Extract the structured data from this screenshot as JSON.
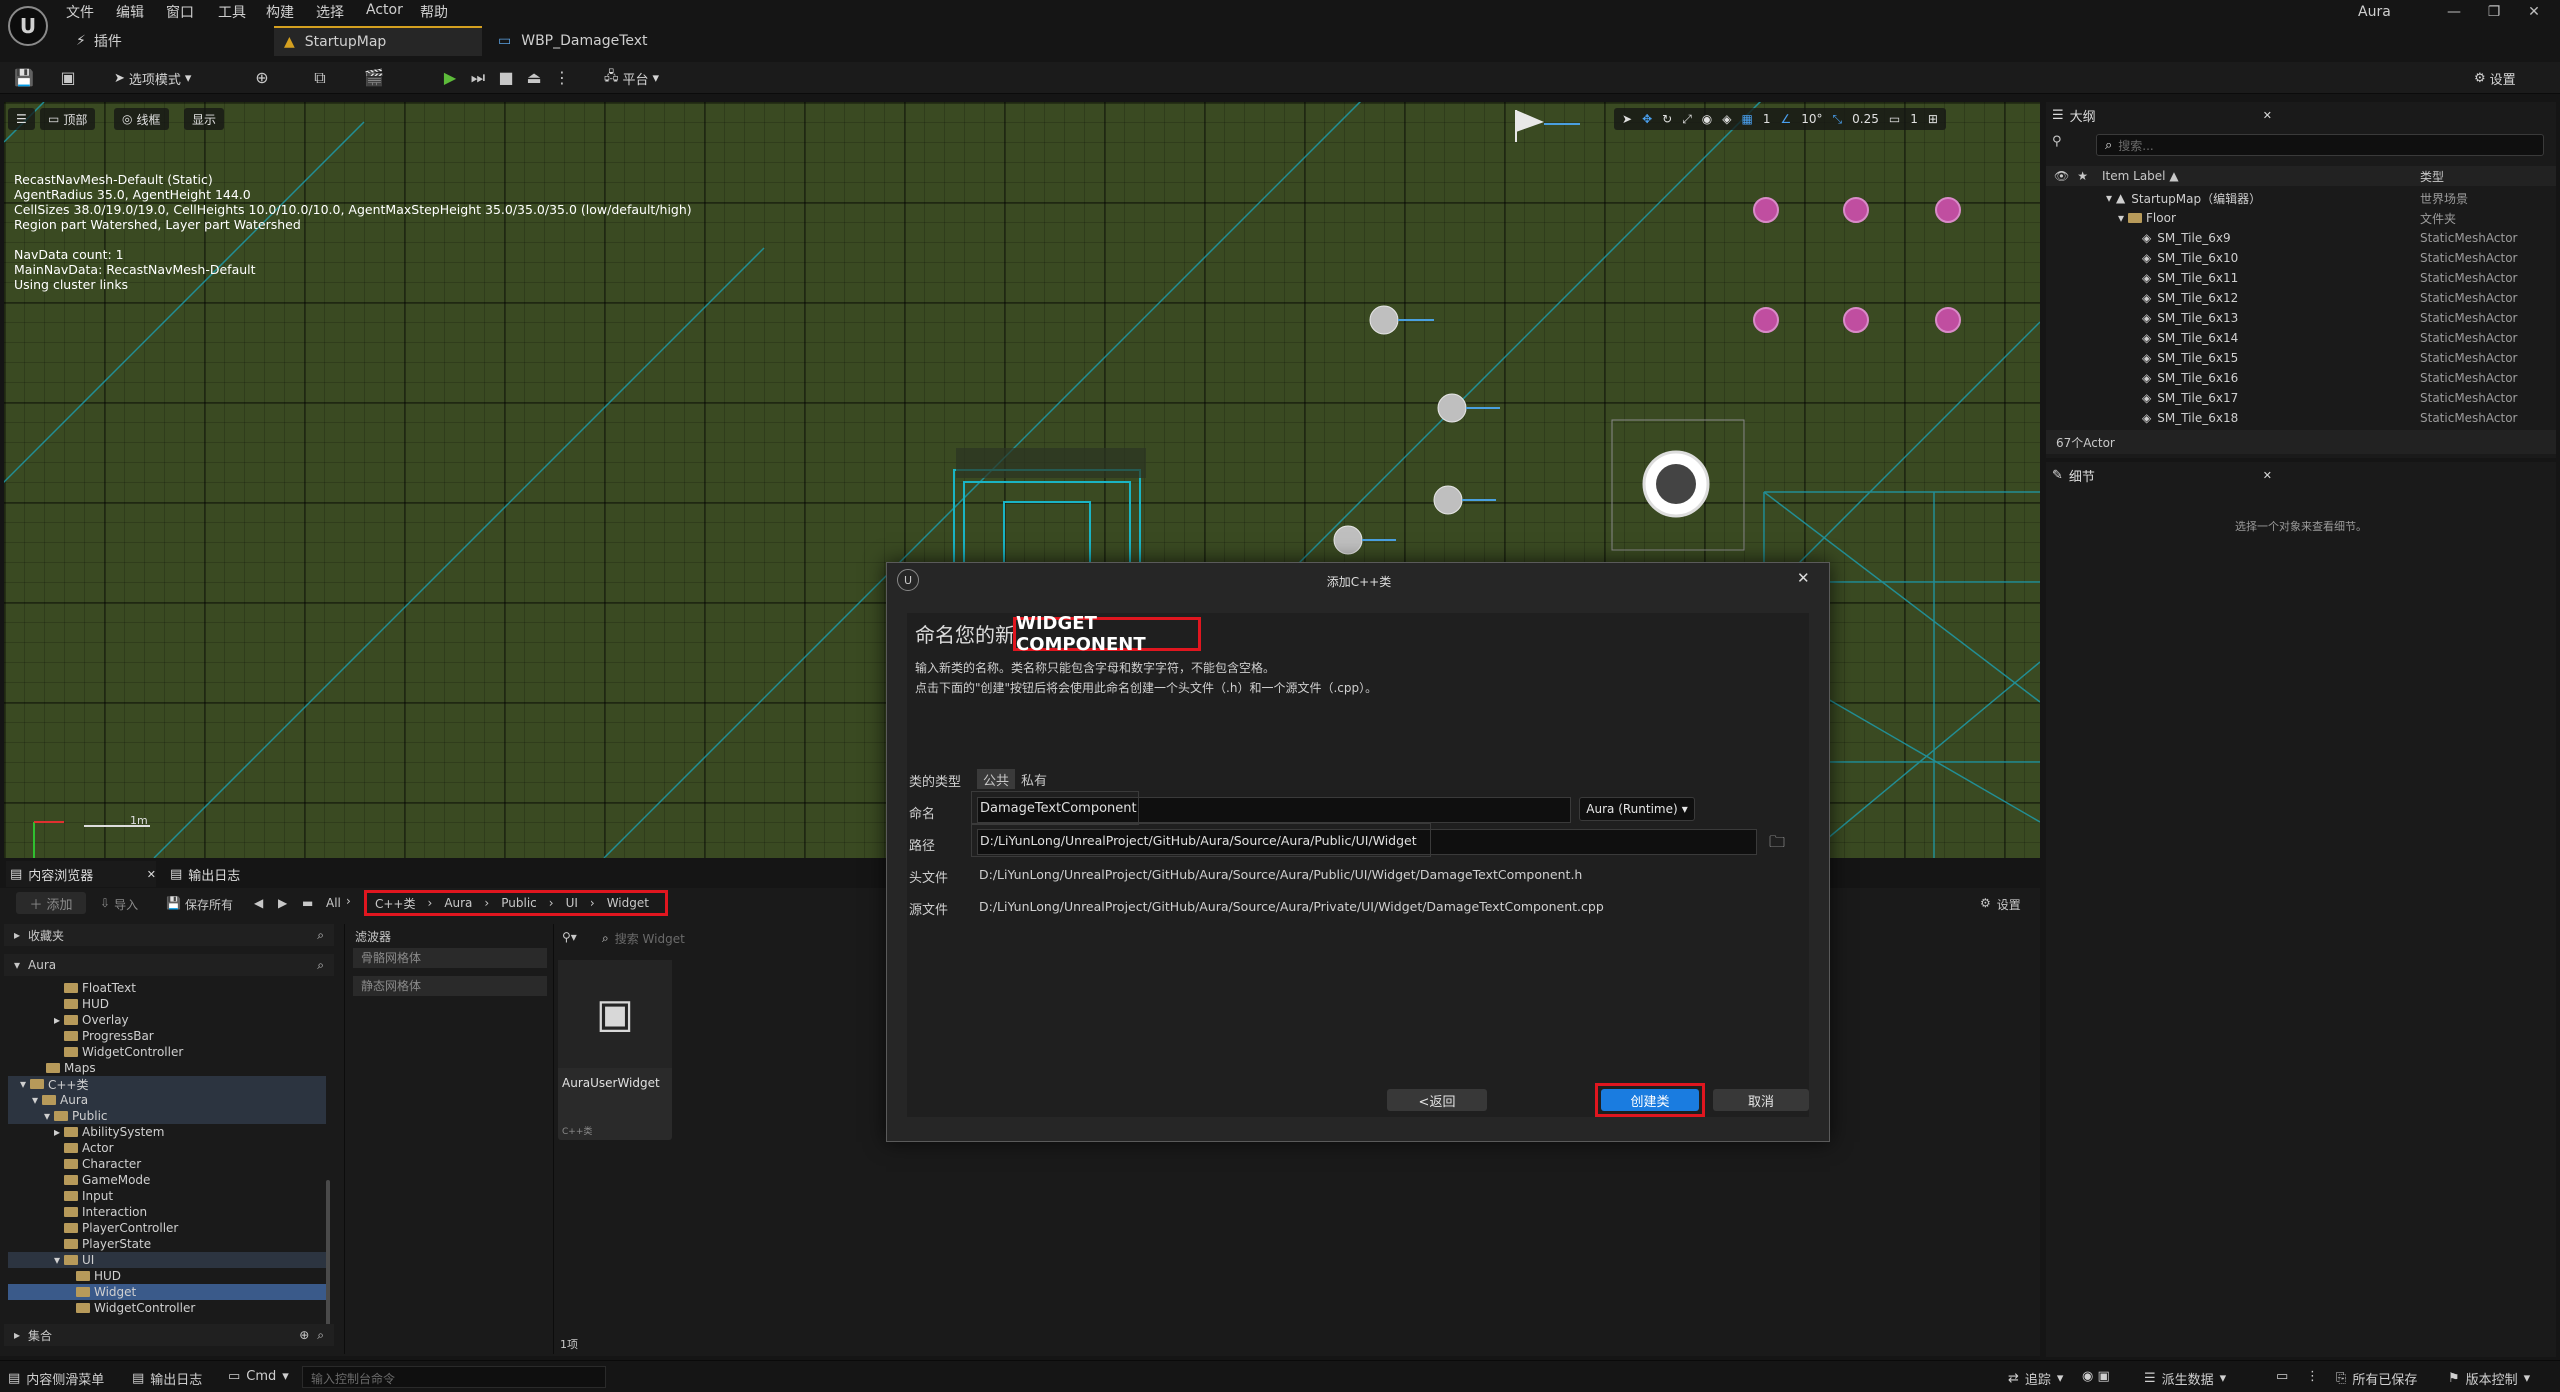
{
  "app": {
    "project_name": "Aura"
  },
  "menu": [
    "文件",
    "编辑",
    "窗口",
    "工具",
    "构建",
    "选择",
    "Actor",
    "帮助"
  ],
  "tabs": {
    "plugin": "插件",
    "map": "StartupMap",
    "widget_bp": "WBP_DamageText"
  },
  "toolbar": {
    "select_mode": "选项模式",
    "platform": "平台",
    "settings": "设置"
  },
  "viewport": {
    "perspective": "顶部",
    "view_mode": "线框",
    "show": "显示",
    "grid_snap": "1",
    "rotation_snap": "10°",
    "scale_snap": "0.25",
    "camera_speed": "1",
    "scale_label": "1m",
    "nav_info": "RecastNavMesh-Default (Static)\nAgentRadius 35.0, AgentHeight 144.0\nCellSizes 38.0/19.0/19.0, CellHeights 10.0/10.0/10.0, AgentMaxStepHeight 35.0/35.0/35.0 (low/default/high)\nRegion part Watershed, Layer part Watershed\n\nNavData count: 1\nMainNavData: RecastNavMesh-Default\nUsing cluster links"
  },
  "outliner": {
    "title": "大纲",
    "search_placeholder": "搜索...",
    "col_label": "Item Label ▲",
    "col_type": "类型",
    "rows": [
      {
        "label": "StartupMap（编辑器）",
        "type": "世界场景"
      },
      {
        "label": "Floor",
        "type": "文件夹"
      },
      {
        "label": "SM_Tile_6x9",
        "type": "StaticMeshActor"
      },
      {
        "label": "SM_Tile_6x10",
        "type": "StaticMeshActor"
      },
      {
        "label": "SM_Tile_6x11",
        "type": "StaticMeshActor"
      },
      {
        "label": "SM_Tile_6x12",
        "type": "StaticMeshActor"
      },
      {
        "label": "SM_Tile_6x13",
        "type": "StaticMeshActor"
      },
      {
        "label": "SM_Tile_6x14",
        "type": "StaticMeshActor"
      },
      {
        "label": "SM_Tile_6x15",
        "type": "StaticMeshActor"
      },
      {
        "label": "SM_Tile_6x16",
        "type": "StaticMeshActor"
      },
      {
        "label": "SM_Tile_6x17",
        "type": "StaticMeshActor"
      },
      {
        "label": "SM_Tile_6x18",
        "type": "StaticMeshActor"
      }
    ],
    "actor_count": "67个Actor"
  },
  "details": {
    "title": "细节",
    "empty_hint": "选择一个对象来查看细节。"
  },
  "content_browser": {
    "tab": "内容浏览器",
    "log_tab": "输出日志",
    "add": "添加",
    "import": "导入",
    "save_all": "保存所有",
    "all": "All",
    "breadcrumb": [
      "C++类",
      "Aura",
      "Public",
      "UI",
      "Widget"
    ],
    "settings": "设置",
    "favorites": "收藏夹",
    "root": "Aura",
    "tree": [
      "FloatText",
      "HUD",
      "Overlay",
      "ProgressBar",
      "WidgetController",
      "Maps",
      "C++类",
      "Aura",
      "Public",
      "AbilitySystem",
      "Actor",
      "Character",
      "GameMode",
      "Input",
      "Interaction",
      "PlayerController",
      "PlayerState",
      "UI",
      "HUD",
      "Widget",
      "WidgetController"
    ],
    "collections": "集合",
    "filters_title": "滤波器",
    "filters": [
      "骨骼网格体",
      "静态网格体"
    ],
    "search_placeholder": "搜索 Widget",
    "asset_name": "AuraUserWidget",
    "asset_type": "C++类",
    "item_count": "1项"
  },
  "dialog": {
    "title": "添加C++类",
    "heading_prefix": "命名您的新",
    "heading_class": "WIDGET COMPONENT",
    "desc1": "输入新类的名称。类名称只能包含字母和数字字符，不能包含空格。",
    "desc2": "点击下面的\"创建\"按钮后将会使用此命名创建一个头文件（.h）和一个源文件（.cpp）。",
    "class_type_label": "类的类型",
    "public": "公共",
    "private": "私有",
    "name_label": "命名",
    "name_value": "DamageTextComponent",
    "module": "Aura (Runtime)",
    "path_label": "路径",
    "path_value": "D:/LiYunLong/UnrealProject/GitHub/Aura/Source/Aura/Public/UI/Widget",
    "header_label": "头文件",
    "header_value": "D:/LiYunLong/UnrealProject/GitHub/Aura/Source/Aura/Public/UI/Widget/DamageTextComponent.h",
    "source_label": "源文件",
    "source_value": "D:/LiYunLong/UnrealProject/GitHub/Aura/Source/Aura/Private/UI/Widget/DamageTextComponent.cpp",
    "back": "<返回",
    "create": "创建类",
    "cancel": "取消"
  },
  "statusbar": {
    "drawer": "内容侧滑菜单",
    "output_log": "输出日志",
    "cmd": "Cmd",
    "cmd_placeholder": "输入控制台命令",
    "trace": "追踪",
    "derived_data": "派生数据",
    "all_saved": "所有已保存",
    "source_control": "版本控制"
  }
}
